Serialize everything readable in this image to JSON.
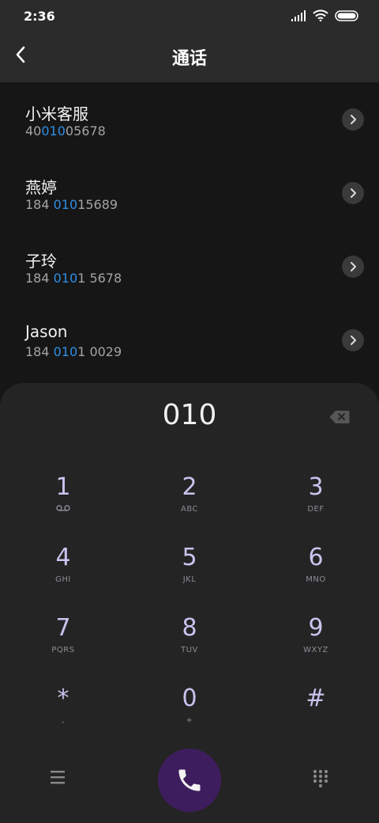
{
  "status": {
    "time": "2:36"
  },
  "header": {
    "title": "通话"
  },
  "contacts": [
    {
      "name": "小米客服",
      "number_pre": "40",
      "number_hl": "010",
      "number_post": "05678"
    },
    {
      "name": "燕婷",
      "number_pre": "184 ",
      "number_hl": "010",
      "number_post": "15689"
    },
    {
      "name": "子玲",
      "number_pre": "184 ",
      "number_hl": "010",
      "number_post": "1 5678"
    },
    {
      "name": "Jason",
      "number_pre": "184 ",
      "number_hl": "010",
      "number_post": "1 0029"
    }
  ],
  "dialpad": {
    "entered_number": "010",
    "keys": [
      {
        "digit": "1",
        "letters": "",
        "icon": "voicemail-icon"
      },
      {
        "digit": "2",
        "letters": "ABC"
      },
      {
        "digit": "3",
        "letters": "DEF"
      },
      {
        "digit": "4",
        "letters": "GHI"
      },
      {
        "digit": "5",
        "letters": "JKL"
      },
      {
        "digit": "6",
        "letters": "MNO"
      },
      {
        "digit": "7",
        "letters": "PQRS"
      },
      {
        "digit": "8",
        "letters": "TUV"
      },
      {
        "digit": "9",
        "letters": "WXYZ"
      },
      {
        "digit": "*",
        "letters": ","
      },
      {
        "digit": "0",
        "letters": "+"
      },
      {
        "digit": "#",
        "letters": ""
      }
    ]
  },
  "colors": {
    "highlight": "#2f8ee6",
    "call_button": "#3e1d5e",
    "key_digit": "#c9c3ee"
  }
}
